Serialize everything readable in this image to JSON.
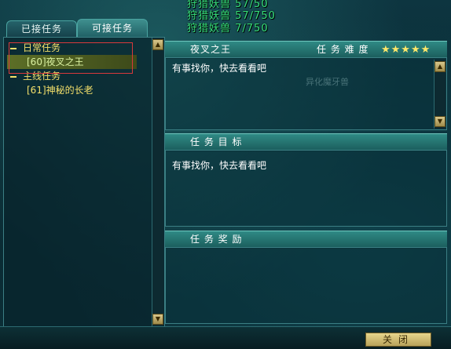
{
  "top_notices": [
    "狩猎妖兽 57/50",
    "狩猎妖兽 57/750",
    "狩猎妖兽 7/750"
  ],
  "tabs": [
    {
      "label": "已接任务",
      "active": false
    },
    {
      "label": "可接任务",
      "active": true
    }
  ],
  "tree": {
    "daily": {
      "label": "日常任务",
      "items": [
        "[60]夜叉之王"
      ]
    },
    "main": {
      "label": "主线任务",
      "items": [
        "[61]神秘的长老"
      ]
    }
  },
  "detail": {
    "quest_name": "夜叉之王",
    "difficulty_label": "任 务 难 度",
    "stars": "★★★★★",
    "description": "有事找你，快去看看吧",
    "background_caption": "异化魔牙兽"
  },
  "objective": {
    "title": "任 务 目 标",
    "text": "有事找你，快去看看吧"
  },
  "reward": {
    "title": "任 务 奖 励"
  },
  "footer": {
    "close_label": "关闭"
  },
  "colors": {
    "category_text": "#f4e06a",
    "selection_outline": "#d8393c",
    "notice_text": "#36e07a",
    "header_bar": "#2f8a85"
  }
}
